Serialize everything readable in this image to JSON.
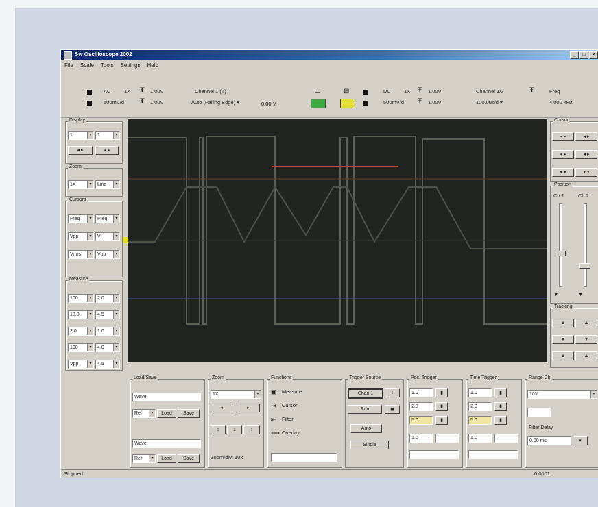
{
  "window": {
    "title": "Sw Oscilloscope 2002",
    "minimize": "_",
    "maximize": "□",
    "close": "×"
  },
  "menu": [
    "File",
    "Scale",
    "Tools",
    "Settings",
    "Help"
  ],
  "toolbar": {
    "ch1_coupling": "AC",
    "ch1_label": "1X",
    "ch1_volts": "1.00V",
    "ch1_div": "500mV/d",
    "ch1_offset": "1.00V",
    "trigger_source": "Channel 1 (T)",
    "trigger_mode": "Auto (Falling Edge) ▾",
    "trigger_level": "0.00 V",
    "ch2_coupling": "DC",
    "ch2_label": "1X",
    "ch2_volts": "1.00V",
    "ch2_div": "500mV/d",
    "ch2_offset": "1.00V",
    "timebase_label": "Channel 1/2",
    "timebase_value": "100.0us/d ▾",
    "freq_label": "Freq",
    "freq_value": "4.000 kHz"
  },
  "left_panel": {
    "display_title": "Display",
    "display_a": "1",
    "display_b": "1",
    "zoom_title": "Zoom",
    "zoom_a": "1X",
    "zoom_b": "Line",
    "cursors_title": "Cursors",
    "cur_a": "Freq",
    "cur_b": "Freq",
    "cur_c": "Vpp",
    "cur_d": "V",
    "cur_e": "Vrms",
    "cur_f": "Vpp",
    "meas_title": "Measure",
    "rows": [
      {
        "a": "100",
        "b": "2.0"
      },
      {
        "a": "10.0",
        "b": "4.5"
      },
      {
        "a": "2.0",
        "b": "1.0"
      },
      {
        "a": "100",
        "b": "4.0"
      },
      {
        "a": "Vpp",
        "b": "4.5"
      }
    ]
  },
  "right_panel": {
    "cursor_title": "Cursor",
    "position_title": "Position",
    "ch_a": "Ch 1",
    "ch_b": "Ch 2",
    "up_label": "▲",
    "down_label": "▼",
    "tracking_title": "Tracking",
    "ch1_slider_pct": 60,
    "ch2_slider_pct": 75
  },
  "bottom": {
    "load_save_title": "Load/Save",
    "file_a": "Wave",
    "file_b": "Wave",
    "load_btn": "Load",
    "save_btn": "Save",
    "mode_a": "Ref",
    "mode_b": "Ref",
    "zoom_title": "Zoom",
    "zoom_value": "1X",
    "zoom_step": "1",
    "zoom_ratio": "Zoom/div: 10x",
    "functions_title": "Functions",
    "functions": [
      "Measure",
      "Cursor",
      "Filter",
      "Overlay"
    ],
    "trigger_title": "Trigger Source",
    "trigger_ch": "Chan 1",
    "trigger_single": "Single",
    "trigger_run": "Run",
    "trigger_stop": "Stop",
    "trigger_auto": "Auto",
    "pos_title": "Pos. Trigger",
    "time_title": "Time Trigger",
    "pos_vals": [
      "1.0",
      "2.0",
      "5.0",
      "1.0"
    ],
    "time_vals": [
      "1.0",
      "2.0",
      "5.0",
      "1.0"
    ],
    "range_title": "Range Ch",
    "range_val": "10V",
    "delay_title": "Filter Delay",
    "delay_val": "0.00 ms"
  },
  "status": {
    "left": "Stopped",
    "right": "0.0001"
  },
  "colors": {
    "trace_ch1": "#5c5f55",
    "trace_red": "#c84a30",
    "trace_blue": "#3d5a9a",
    "scope_bg": "#222422",
    "ch1_swatch": "#3faa3f",
    "ch2_swatch": "#e6e13a",
    "marker": "#e6d930"
  }
}
